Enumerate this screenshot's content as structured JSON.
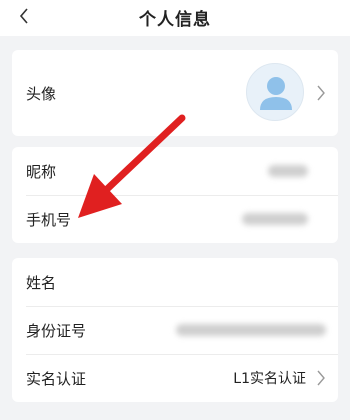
{
  "nav": {
    "title": "个人信息",
    "back_icon": "chevron-left-icon"
  },
  "avatar_section": {
    "label": "头像",
    "avatar_icon": "user-avatar-icon",
    "chevron_icon": "chevron-right-icon"
  },
  "account_section": {
    "nickname_label": "昵称",
    "phone_label": "手机号"
  },
  "identity_section": {
    "name_label": "姓名",
    "id_label": "身份证号",
    "verify_label": "实名认证",
    "verify_value": "L1实名认证",
    "chevron_icon": "chevron-right-icon"
  },
  "annotation": {
    "arrow_color": "#e02020",
    "arrow_icon": "red-arrow-icon"
  },
  "colors": {
    "background": "#f2f3f5",
    "card": "#ffffff",
    "avatar_bg": "#e8f1f9",
    "avatar_figure": "#8fc1ea"
  }
}
